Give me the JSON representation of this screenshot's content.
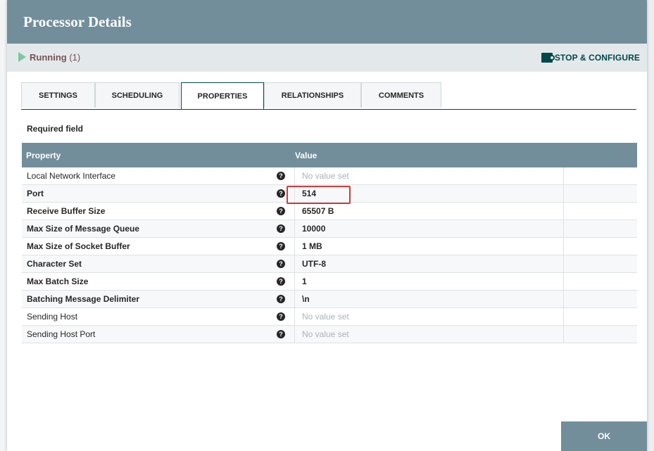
{
  "dialog": {
    "title": "Processor Details"
  },
  "status": {
    "state": "Running",
    "count": "(1)",
    "stop_configure_label": "STOP & CONFIGURE"
  },
  "tabs": [
    {
      "label": "SETTINGS",
      "active": false
    },
    {
      "label": "SCHEDULING",
      "active": false
    },
    {
      "label": "PROPERTIES",
      "active": true
    },
    {
      "label": "RELATIONSHIPS",
      "active": false
    },
    {
      "label": "COMMENTS",
      "active": false
    }
  ],
  "required_field_label": "Required field",
  "grid": {
    "columns": [
      "Property",
      "Value"
    ],
    "rows": [
      {
        "property": "Local Network Interface",
        "required": false,
        "value": "No value set",
        "empty": true
      },
      {
        "property": "Port",
        "required": true,
        "value": "514",
        "empty": false
      },
      {
        "property": "Receive Buffer Size",
        "required": true,
        "value": "65507 B",
        "empty": false
      },
      {
        "property": "Max Size of Message Queue",
        "required": true,
        "value": "10000",
        "empty": false
      },
      {
        "property": "Max Size of Socket Buffer",
        "required": true,
        "value": "1 MB",
        "empty": false
      },
      {
        "property": "Character Set",
        "required": true,
        "value": "UTF-8",
        "empty": false
      },
      {
        "property": "Max Batch Size",
        "required": true,
        "value": "1",
        "empty": false
      },
      {
        "property": "Batching Message Delimiter",
        "required": true,
        "value": "\\n",
        "empty": false
      },
      {
        "property": "Sending Host",
        "required": false,
        "value": "No value set",
        "empty": true
      },
      {
        "property": "Sending Host Port",
        "required": false,
        "value": "No value set",
        "empty": true
      }
    ]
  },
  "buttons": {
    "ok_label": "OK"
  },
  "icons": {
    "running": "play-triangle-icon",
    "stop_configure": "stop-configure-icon",
    "help": "question-circle-icon"
  },
  "colors": {
    "header": "#728e9b",
    "accent": "#004849",
    "running": "#7dc7a0",
    "highlight": "#d63a3a"
  }
}
